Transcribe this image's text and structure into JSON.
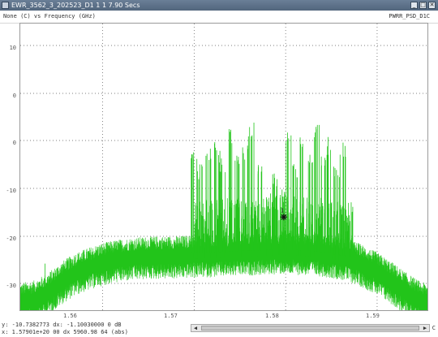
{
  "window": {
    "title": "EWR_3562_3_202523_D1 1 1 7.90 Secs",
    "buttons": [
      "_",
      "□",
      "✕"
    ]
  },
  "header": {
    "left_label": "None (C) vs Frequency (GHz)",
    "right_label": "PWRR_PSD_D1C"
  },
  "colors": {
    "trace": "#22c41a",
    "grid": "#555555",
    "frame": "#9a9a9a"
  },
  "chart_data": {
    "type": "line",
    "y_tick_labels": [
      "10",
      "0",
      "0",
      "-10",
      "-20",
      "-30"
    ],
    "x_tick_labels": [
      "1.56",
      "1.57",
      "1.58",
      "1.59"
    ],
    "xlim": [
      1.551,
      1.5955
    ],
    "ylim": [
      -34,
      14
    ],
    "grid": true,
    "series": [
      {
        "style": "dense-noise",
        "points": [
          [
            1.551,
            -32.4
          ],
          [
            1.5525,
            -32.0
          ],
          [
            1.554,
            -30.8
          ],
          [
            1.5555,
            -28.9
          ],
          [
            1.557,
            -27.4
          ],
          [
            1.5585,
            -26.5
          ],
          [
            1.56,
            -25.7
          ],
          [
            1.5615,
            -25.2
          ],
          [
            1.563,
            -24.9
          ],
          [
            1.5645,
            -24.7
          ],
          [
            1.566,
            -24.6
          ],
          [
            1.5675,
            -24.6
          ],
          [
            1.569,
            -24.5
          ],
          [
            1.5705,
            -24.4
          ],
          [
            1.572,
            -24.3
          ],
          [
            1.5735,
            -24.2
          ],
          [
            1.575,
            -24.1
          ],
          [
            1.5765,
            -24.0
          ],
          [
            1.578,
            -23.9
          ],
          [
            1.5795,
            -23.8
          ],
          [
            1.581,
            -23.9
          ],
          [
            1.5825,
            -24.0
          ],
          [
            1.584,
            -24.2
          ],
          [
            1.5855,
            -24.6
          ],
          [
            1.587,
            -25.1
          ],
          [
            1.5885,
            -26.1
          ],
          [
            1.59,
            -27.3
          ],
          [
            1.5915,
            -28.8
          ],
          [
            1.593,
            -30.5
          ],
          [
            1.5945,
            -32.0
          ],
          [
            1.5955,
            -32.6
          ]
        ]
      }
    ],
    "bursts_x_range": [
      1.5697,
      1.5873
    ],
    "burst_peaks": [
      [
        1.57,
        -10.5
      ],
      [
        1.5706,
        -12.5
      ],
      [
        1.5716,
        -9.8
      ],
      [
        1.5725,
        -8.6
      ],
      [
        1.5731,
        -11.0
      ],
      [
        1.5741,
        -6.6
      ],
      [
        1.5748,
        -10.2
      ],
      [
        1.5756,
        -9.3
      ],
      [
        1.5762,
        -5.4
      ],
      [
        1.5771,
        -11.9
      ],
      [
        1.5782,
        -17.0
      ],
      [
        1.5789,
        -13.8
      ],
      [
        1.5797,
        -16.2
      ],
      [
        1.5804,
        -6.8
      ],
      [
        1.5811,
        -12.4
      ],
      [
        1.5819,
        -7.4
      ],
      [
        1.5826,
        -9.6
      ],
      [
        1.5834,
        -5.7
      ],
      [
        1.5842,
        -10.4
      ],
      [
        1.5848,
        -8.0
      ],
      [
        1.5856,
        -12.6
      ],
      [
        1.5862,
        -8.9
      ],
      [
        1.587,
        -18.3
      ]
    ],
    "marker": {
      "label": "1",
      "x": 1.5798,
      "y": -18.4
    }
  },
  "readout": {
    "line1": "y: -10.7382773  dx: -1.10030000  0 dB",
    "line2": "x: 1.57901e+20 00 dx  5960.98 64  (abs)"
  },
  "scrollbar": {
    "left_arrow": "◀",
    "right_arrow": "▶"
  },
  "right_marker": "C"
}
